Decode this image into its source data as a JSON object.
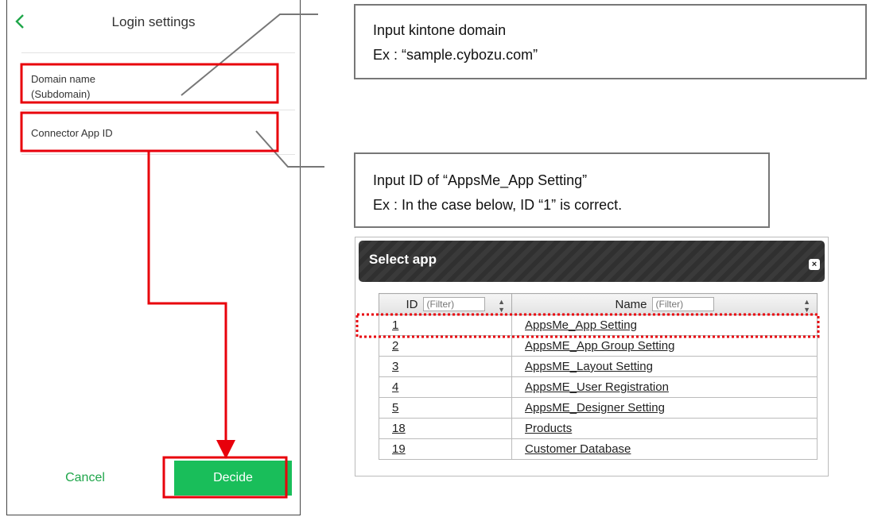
{
  "phone": {
    "title": "Login settings",
    "domain_label_line1": "Domain name",
    "domain_label_line2": "(Subdomain)",
    "connector_label": "Connector App ID",
    "cancel_label": "Cancel",
    "decide_label": "Decide",
    "accent_color": "#19be5a",
    "icons": {
      "back": "chevron-left-icon"
    }
  },
  "callouts": {
    "domain_line1": "Input kintone domain",
    "domain_line2": "Ex : “sample.cybozu.com”",
    "appid_line1": "Input ID of “AppsMe_App Setting”",
    "appid_line2": "Ex : In the case below, ID “1” is correct."
  },
  "highlight_color": "#e8000b",
  "dialog": {
    "title": "Select app",
    "close_glyph": "×",
    "columns": {
      "id": "ID",
      "name": "Name",
      "filter_placeholder": "(Filter)"
    },
    "rows": [
      {
        "id": "1",
        "name": "AppsMe_App Setting"
      },
      {
        "id": "2",
        "name": "AppsME_App Group Setting"
      },
      {
        "id": "3",
        "name": "AppsME_Layout Setting"
      },
      {
        "id": "4",
        "name": "AppsME_User Registration"
      },
      {
        "id": "5",
        "name": "AppsME_Designer Setting"
      },
      {
        "id": "18",
        "name": "Products"
      },
      {
        "id": "19",
        "name": "Customer Database"
      }
    ]
  }
}
